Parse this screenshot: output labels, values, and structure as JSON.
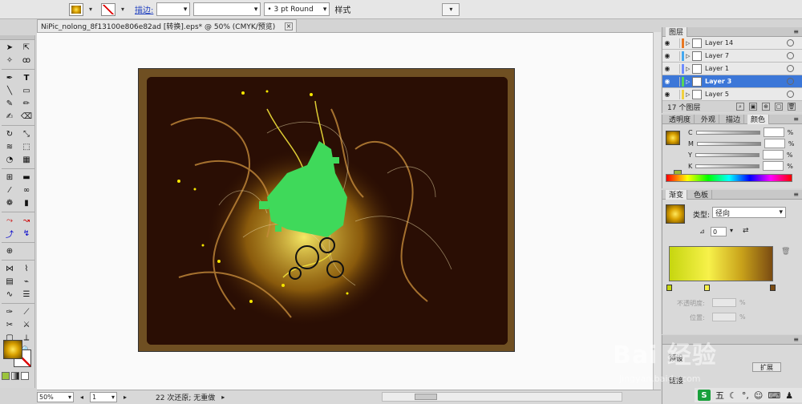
{
  "controlbar": {
    "stroke_label": "描边:",
    "brush_value": "3 pt Round",
    "style_label": "样式"
  },
  "document": {
    "tab_title": "NiPic_nolong_8f13100e806e82ad  [转换].eps* @ 50% (CMYK/预览)",
    "close_glyph": "×"
  },
  "statusbar": {
    "zoom": "50%",
    "artboard": "1",
    "status_text": "22 次还原; 无重做"
  },
  "layers_panel": {
    "title": "图层",
    "items": [
      {
        "name": "Layer 14",
        "color": "#e87824",
        "selected": false
      },
      {
        "name": "Layer 7",
        "color": "#44a8f0",
        "selected": false
      },
      {
        "name": "Layer 1",
        "color": "#6f8cff",
        "selected": false
      },
      {
        "name": "Layer 3",
        "color": "#58d858",
        "selected": true
      },
      {
        "name": "Layer 5",
        "color": "#f0d040",
        "selected": false
      }
    ],
    "count": "17 个图层"
  },
  "color_panel": {
    "tabs": [
      "透明度",
      "外观",
      "描边",
      "颜色"
    ],
    "active_tab": "颜色",
    "channels": [
      "C",
      "M",
      "Y",
      "K"
    ],
    "unit": "%"
  },
  "gradient_panel": {
    "tabs": [
      "渐变",
      "色板"
    ],
    "active_tab": "渐变",
    "type_label": "类型:",
    "type_value": "径向",
    "angle_value": "0",
    "opacity_label": "不透明度:",
    "position_label": "位置:",
    "unit": "%"
  },
  "bottom_panel": {
    "label1": "预设",
    "label2": "链接",
    "expand_label": "扩展"
  },
  "watermark": {
    "main": "Bai 经验",
    "sub": "jingyan.baidu.com"
  },
  "ime": {
    "logo": "S",
    "label": "五"
  }
}
